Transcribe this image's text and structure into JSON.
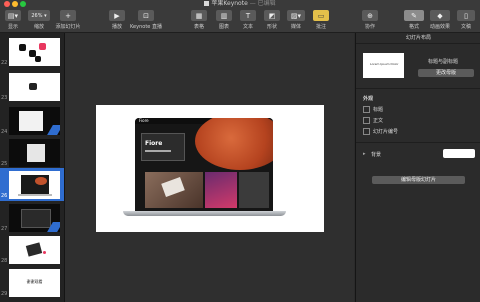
{
  "window": {
    "title": "苹果Keynote",
    "edited": " — 已编辑",
    "traffic_colors": [
      "#ff5f57",
      "#febc2e",
      "#28c840"
    ]
  },
  "toolbar": {
    "view_label": "显示",
    "zoom_value": "26%",
    "zoom_label": "缩放",
    "add_slide_label": "添加幻灯片",
    "play_label": "播放",
    "keynote_live_label": "Keynote 直播",
    "table_label": "表格",
    "chart_label": "图表",
    "text_label": "文本",
    "shape_label": "形状",
    "media_label": "媒体",
    "comment_label": "批注",
    "collaborate_label": "协作",
    "format_label": "格式",
    "animate_label": "动画效果",
    "document_label": "文稿"
  },
  "navigator": {
    "slides": [
      {
        "num": "22"
      },
      {
        "num": "23"
      },
      {
        "num": "24"
      },
      {
        "num": "25"
      },
      {
        "num": "26"
      },
      {
        "num": "27"
      },
      {
        "num": "28"
      },
      {
        "num": "29"
      }
    ],
    "slide29_text": "谢谢观看"
  },
  "slide": {
    "brand": "Fiore",
    "hero_title": "Fiore"
  },
  "inspector": {
    "header": "幻灯片布局",
    "layout_name": "标题与副标题",
    "layout_thumb_text": "Lorem Ipsum Dolor",
    "change_master_button": "更改母版",
    "appearance_heading": "外观",
    "title_checkbox": "标题",
    "body_checkbox": "正文",
    "slide_number_checkbox": "幻灯片编号",
    "background_label": "背景",
    "edit_master_button": "编辑母版幻灯片"
  },
  "colors": {
    "selection": "#2f6dd0",
    "mars": "#c2522c",
    "button": "#5b5b5b"
  }
}
